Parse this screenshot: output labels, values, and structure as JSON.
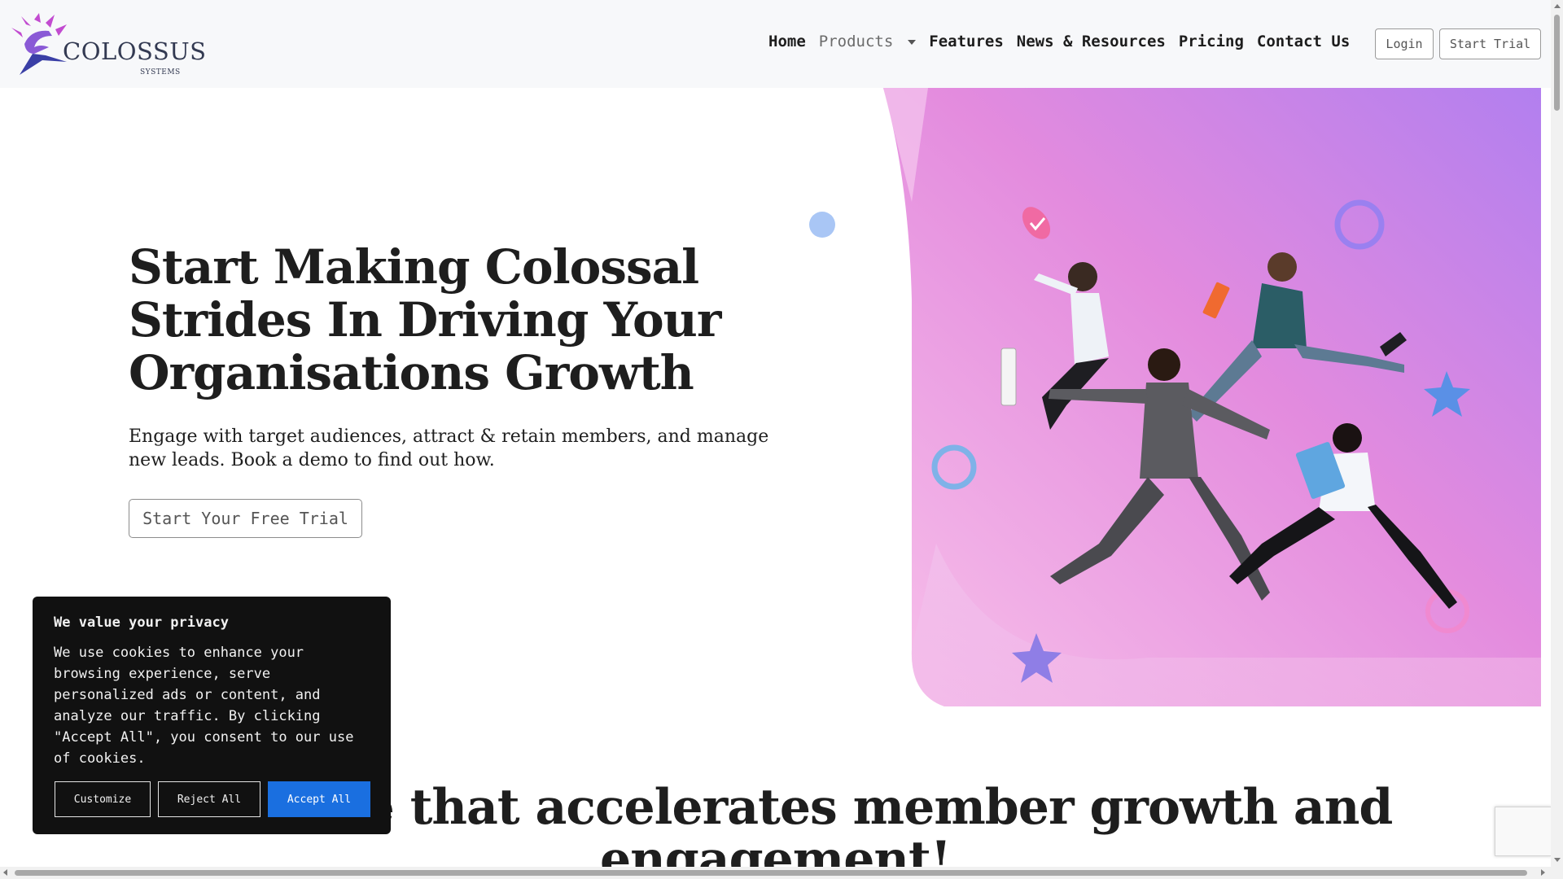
{
  "header": {
    "logo_name": "COLOSSUS",
    "logo_sub": "SYSTEMS",
    "nav": [
      {
        "label": "Home"
      },
      {
        "label": "Products"
      },
      {
        "label": "Features"
      },
      {
        "label": "News & Resources"
      },
      {
        "label": "Pricing"
      },
      {
        "label": "Contact Us"
      }
    ],
    "login_label": "Login",
    "trial_label": "Start Trial"
  },
  "hero": {
    "title": "Start Making Colossal Strides In Driving Your Organisations Growth",
    "subtitle": "Engage with target audiences, attract & retain members, and manage new leads. Book a demo to find out how.",
    "cta_label": "Start Your Free Trial"
  },
  "section": {
    "title": "Software that accelerates member growth and engagement!"
  },
  "cookie_banner": {
    "title": "We value your privacy",
    "body": "We use cookies to enhance your browsing experience, serve personalized ads or content, and analyze our traffic. By clicking \"Accept All\", you consent to our use of cookies.",
    "customize_label": "Customize",
    "reject_label": "Reject All",
    "accept_label": "Accept All"
  },
  "colors": {
    "accent": "#1a6fe0",
    "hero_gradient_start": "#f6b6e6",
    "hero_gradient_end": "#b784f0"
  },
  "icons": {
    "logo": "colossus-logo-icon",
    "dropdown": "chevron-down-icon"
  }
}
